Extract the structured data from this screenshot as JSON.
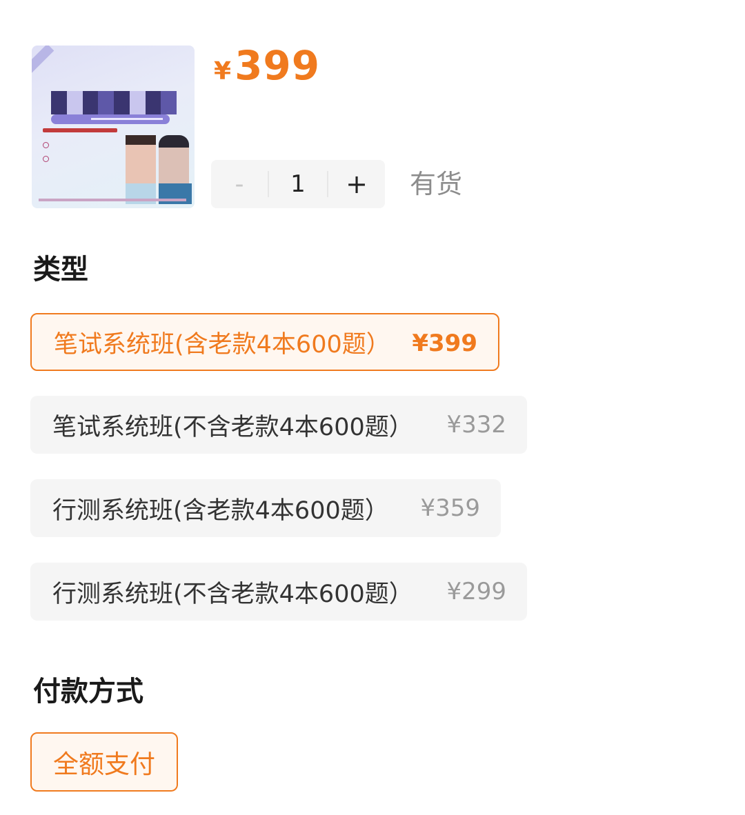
{
  "product": {
    "price": "399",
    "currency": "¥"
  },
  "quantity": {
    "minus": "-",
    "value": "1",
    "plus": "+"
  },
  "stock_status": "有货",
  "type_section": {
    "title": "类型",
    "options": [
      {
        "label": "笔试系统班(含老款4本600题）",
        "price": "¥399",
        "selected": true
      },
      {
        "label": "笔试系统班(不含老款4本600题）",
        "price": "¥332",
        "selected": false
      },
      {
        "label": "行测系统班(含老款4本600题）",
        "price": "¥359",
        "selected": false
      },
      {
        "label": "行测系统班(不含老款4本600题）",
        "price": "¥299",
        "selected": false
      }
    ]
  },
  "payment_section": {
    "title": "付款方式",
    "options": [
      {
        "label": "全额支付",
        "selected": true
      }
    ]
  },
  "colors": {
    "accent": "#f07a1e",
    "selected_bg": "#fff7f0",
    "option_bg": "#f5f5f5",
    "muted_text": "#9a9a9a"
  }
}
